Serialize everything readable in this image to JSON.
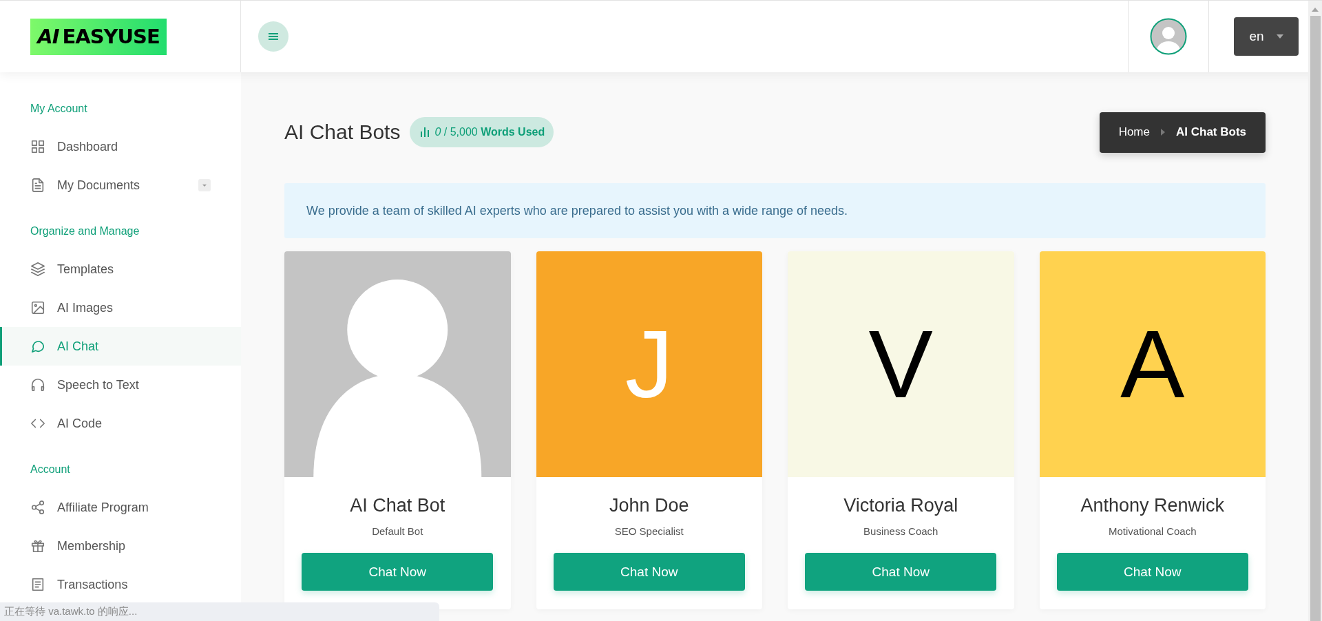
{
  "header": {
    "logo": {
      "mark": "AI",
      "text": "EASYUSE"
    },
    "language": "en"
  },
  "sidebar": {
    "sections": [
      {
        "title": "My Account",
        "items": [
          {
            "label": "Dashboard",
            "kind": "link",
            "selected": false
          },
          {
            "label": "My Documents",
            "kind": "dropdown",
            "selected": false
          }
        ]
      },
      {
        "title": "Organize and Manage",
        "items": [
          {
            "label": "Templates",
            "kind": "link",
            "selected": false
          },
          {
            "label": "AI Images",
            "kind": "link",
            "selected": false
          },
          {
            "label": "AI Chat",
            "kind": "link",
            "selected": true
          },
          {
            "label": "Speech to Text",
            "kind": "link",
            "selected": false
          },
          {
            "label": "AI Code",
            "kind": "link",
            "selected": false
          }
        ]
      },
      {
        "title": "Account",
        "items": [
          {
            "label": "Affiliate Program",
            "kind": "link",
            "selected": false
          },
          {
            "label": "Membership",
            "kind": "link",
            "selected": false
          },
          {
            "label": "Transactions",
            "kind": "link",
            "selected": false
          }
        ]
      }
    ]
  },
  "page": {
    "title": "AI Chat Bots",
    "usage": {
      "used": "0",
      "total": "/ 5,000",
      "label": "Words Used"
    },
    "breadcrumb": [
      {
        "label": "Home"
      },
      {
        "label": "AI Chat Bots"
      }
    ],
    "notice": "We provide a team of skilled AI experts who are prepared to assist you with a wide range of needs."
  },
  "bots": [
    {
      "name": "AI Chat Bot",
      "role": "Default Bot",
      "avatar": {
        "kind": "silhouette",
        "color": "#c4c4c4"
      },
      "button": "Chat Now"
    },
    {
      "name": "John Doe",
      "role": "SEO Specialist",
      "avatar": {
        "kind": "letter",
        "letter": "J",
        "color": "#f8a627"
      },
      "button": "Chat Now"
    },
    {
      "name": "Victoria Royal",
      "role": "Business Coach",
      "avatar": {
        "kind": "letter",
        "letter": "V",
        "color": "#f8f8e5"
      },
      "button": "Chat Now"
    },
    {
      "name": "Anthony Renwick",
      "role": "Motivational Coach",
      "avatar": {
        "kind": "letter",
        "letter": "A",
        "color": "#ffd24f"
      },
      "button": "Chat Now"
    }
  ],
  "status_bar": {
    "text": "正在等待 va.tawk.to 的响应..."
  }
}
